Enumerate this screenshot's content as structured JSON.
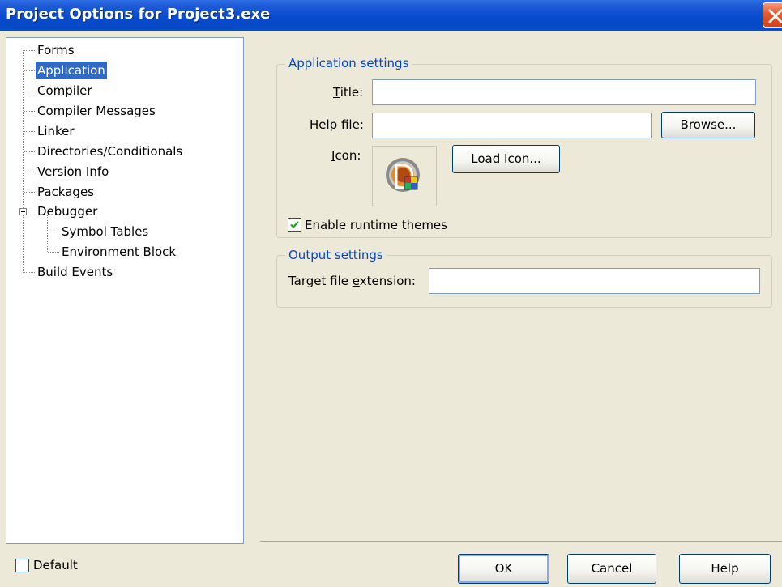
{
  "window": {
    "title": "Project Options for Project3.exe"
  },
  "tree": {
    "items": [
      {
        "label": "Forms",
        "selected": false
      },
      {
        "label": "Application",
        "selected": true
      },
      {
        "label": "Compiler",
        "selected": false
      },
      {
        "label": "Compiler Messages",
        "selected": false
      },
      {
        "label": "Linker",
        "selected": false
      },
      {
        "label": "Directories/Conditionals",
        "selected": false
      },
      {
        "label": "Version Info",
        "selected": false
      },
      {
        "label": "Packages",
        "selected": false
      },
      {
        "label": "Debugger",
        "selected": false,
        "expanded": true
      },
      {
        "label": "Symbol Tables",
        "selected": false
      },
      {
        "label": "Environment Block",
        "selected": false
      },
      {
        "label": "Build Events",
        "selected": false
      }
    ]
  },
  "app_settings": {
    "group_title": "Application settings",
    "title_label_prefix": "",
    "title_label_ul": "T",
    "title_label_rest": "itle:",
    "title_value": "",
    "helpfile_label_prefix": "Help ",
    "helpfile_label_ul": "f",
    "helpfile_label_rest": "ile:",
    "helpfile_value": "",
    "browse_label": "Browse...",
    "icon_label_prefix": "",
    "icon_label_ul": "I",
    "icon_label_rest": "con:",
    "load_icon_label": "Load Icon...",
    "runtime_themes_label": "Enable runtime themes",
    "runtime_themes_checked": true
  },
  "output_settings": {
    "group_title": "Output settings",
    "ext_label_prefix": "Target file ",
    "ext_label_ul": "e",
    "ext_label_rest": "xtension:",
    "ext_value": ""
  },
  "footer": {
    "default_label": "Default",
    "default_checked": false,
    "ok_label": "OK",
    "cancel_label": "Cancel",
    "help_label": "Help"
  },
  "colors": {
    "title_bar": "#0a4dd0",
    "selection": "#316ac5",
    "group_title": "#0046d5",
    "dialog_bg": "#ece9d8"
  }
}
